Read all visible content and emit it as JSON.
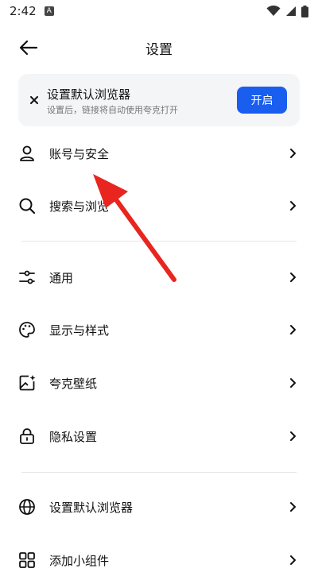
{
  "status": {
    "time": "2:42",
    "app_badge": "A"
  },
  "header": {
    "title": "设置"
  },
  "banner": {
    "title": "设置默认浏览器",
    "subtitle": "设置后，链接将自动使用夸克打开",
    "button_label": "开启"
  },
  "menu": {
    "account": "账号与安全",
    "search": "搜索与浏览",
    "general": "通用",
    "display": "显示与样式",
    "wallpaper": "夸克壁纸",
    "privacy": "隐私设置",
    "default_browser": "设置默认浏览器",
    "widget": "添加小组件"
  },
  "colors": {
    "accent": "#1a5ef0",
    "annotation_arrow": "#e8251f"
  }
}
